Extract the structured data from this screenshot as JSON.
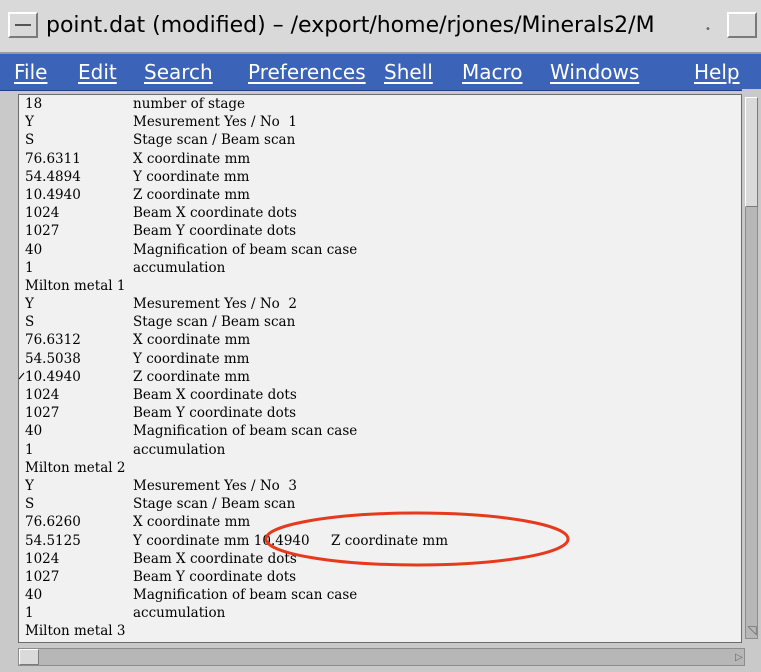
{
  "window": {
    "title": "point.dat (modified) – /export/home/rjones/Minerals2/M"
  },
  "titlebar_icons": {
    "sysmenu": "window-menu-icon",
    "minimize": "minimize-icon",
    "maximize": "maximize-icon"
  },
  "menubar": {
    "items": [
      "File",
      "Edit",
      "Search",
      "Preferences",
      "Shell",
      "Macro",
      "Windows",
      "Help"
    ]
  },
  "editor": {
    "lines": [
      {
        "num": "18",
        "desc": "number of stage"
      },
      {
        "num": "Y",
        "desc": "Mesurement Yes / No  1"
      },
      {
        "num": "S",
        "desc": "Stage scan / Beam scan"
      },
      {
        "num": "76.6311",
        "desc": "X coordinate mm"
      },
      {
        "num": "54.4894",
        "desc": "Y coordinate mm"
      },
      {
        "num": "10.4940",
        "desc": "Z coordinate mm"
      },
      {
        "num": "1024",
        "desc": "Beam X coordinate dots"
      },
      {
        "num": "1027",
        "desc": "Beam Y coordinate dots"
      },
      {
        "num": "40",
        "desc": "Magnification of beam scan case"
      },
      {
        "num": "1",
        "desc": "accumulation"
      },
      {
        "num": "Milton metal 1",
        "desc": ""
      },
      {
        "num": "Y",
        "desc": "Mesurement Yes / No  2"
      },
      {
        "num": "S",
        "desc": "Stage scan / Beam scan"
      },
      {
        "num": "76.6312",
        "desc": "X coordinate mm"
      },
      {
        "num": "54.5038",
        "desc": "Y coordinate mm"
      },
      {
        "num": "10.4940",
        "desc": "Z coordinate mm"
      },
      {
        "num": "1024",
        "desc": "Beam X coordinate dots"
      },
      {
        "num": "1027",
        "desc": "Beam Y coordinate dots"
      },
      {
        "num": "40",
        "desc": "Magnification of beam scan case"
      },
      {
        "num": "1",
        "desc": "accumulation"
      },
      {
        "num": "Milton metal 2",
        "desc": ""
      },
      {
        "num": "Y",
        "desc": "Mesurement Yes / No  3"
      },
      {
        "num": "S",
        "desc": "Stage scan / Beam scan"
      },
      {
        "num": "76.6260",
        "desc": "X coordinate mm"
      },
      {
        "num": "54.5125",
        "desc": "Y coordinate mm 10.4940     Z coordinate mm"
      },
      {
        "num": "1024",
        "desc": "Beam X coordinate dots"
      },
      {
        "num": "1027",
        "desc": "Beam Y coordinate dots"
      },
      {
        "num": "40",
        "desc": "Magnification of beam scan case"
      },
      {
        "num": "1",
        "desc": "accumulation"
      },
      {
        "num": "Milton metal 3",
        "desc": ""
      }
    ]
  },
  "colors": {
    "menubar_bg": "#3b63b8",
    "annotation": "#e53a1d",
    "text_bg": "#f1f1f1"
  }
}
